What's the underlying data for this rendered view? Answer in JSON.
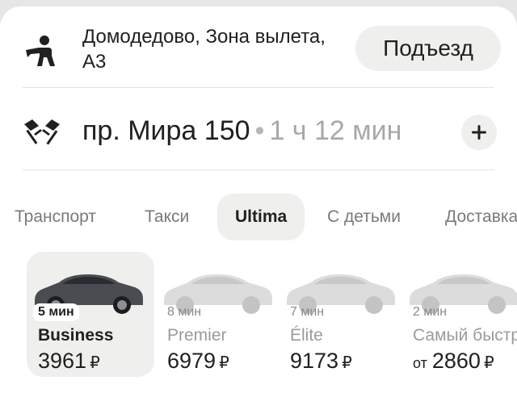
{
  "route": {
    "from": {
      "icon": "person-pin-icon",
      "address": "Домодедово, Зона вылета, А3",
      "entrance_button": "Подъезд"
    },
    "to": {
      "icon": "finish-flags-icon",
      "address": "пр. Мира 150",
      "separator": "•",
      "eta": "1 ч 12 мин",
      "add_button_icon": "plus-icon"
    }
  },
  "tabs": [
    {
      "label": "Транспорт",
      "active": false
    },
    {
      "label": "Такси",
      "active": false
    },
    {
      "label": "Ultima",
      "active": true
    },
    {
      "label": "С детьми",
      "active": false
    },
    {
      "label": "Доставка",
      "active": false
    }
  ],
  "tariffs": [
    {
      "eta": "5 мин",
      "name": "Business",
      "price_prefix": "",
      "price": "3961",
      "currency": "₽",
      "selected": true
    },
    {
      "eta": "8 мин",
      "name": "Premier",
      "price_prefix": "",
      "price": "6979",
      "currency": "₽",
      "selected": false
    },
    {
      "eta": "7 мин",
      "name": "Élite",
      "price_prefix": "",
      "price": "9173",
      "currency": "₽",
      "selected": false
    },
    {
      "eta": "2 мин",
      "name": "Самый быстрый",
      "price_prefix": "от",
      "price": "2860",
      "currency": "₽",
      "selected": false
    }
  ],
  "colors": {
    "text": "#21201f",
    "muted": "#a8a8a5",
    "chip_bg": "#efefed"
  }
}
